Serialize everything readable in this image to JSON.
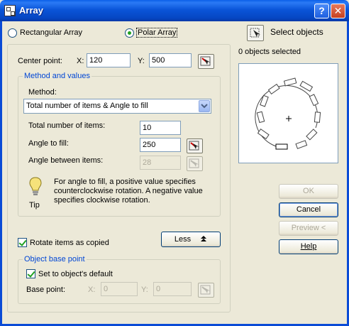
{
  "window": {
    "title": "Array",
    "help_glyph": "?",
    "close_glyph": "✕"
  },
  "array_type": {
    "rectangular_label": "Rectangular Array",
    "polar_label": "Polar Array",
    "selected": "polar"
  },
  "center_point": {
    "label": "Center point:",
    "x_label": "X:",
    "x_value": "120",
    "y_label": "Y:",
    "y_value": "500"
  },
  "method_group": {
    "legend": "Method and values",
    "method_label": "Method:",
    "method_value": "Total number of items & Angle to fill",
    "total_items_label": "Total number of items:",
    "total_items_value": "10",
    "angle_fill_label": "Angle to fill:",
    "angle_fill_value": "250",
    "angle_between_label": "Angle between items:",
    "angle_between_value": "28",
    "tip_text": "For angle to fill, a positive value specifies counterclockwise rotation.  A negative value specifies clockwise rotation.",
    "tip_label": "Tip"
  },
  "rotate_items": {
    "label": "Rotate items as copied",
    "checked": true
  },
  "less_button": {
    "label": "Less"
  },
  "base_point_group": {
    "legend": "Object base point",
    "default_label": "Set to object's default",
    "default_checked": true,
    "base_point_label": "Base point:",
    "x_label": "X:",
    "x_value": "0",
    "y_label": "Y:",
    "y_value": "0"
  },
  "selection": {
    "select_label": "Select objects",
    "status": "0 objects selected"
  },
  "buttons": {
    "ok": "OK",
    "cancel": "Cancel",
    "preview": "Preview <",
    "help": "Help"
  },
  "icons": {
    "pick": "pick-point-icon",
    "select": "select-objects-icon",
    "tip": "lightbulb-icon",
    "dropdown": "chevron-down-icon"
  },
  "colors": {
    "titlebar": "#0a55d9",
    "group_legend": "#0046d5",
    "check_mark": "#21a121"
  }
}
